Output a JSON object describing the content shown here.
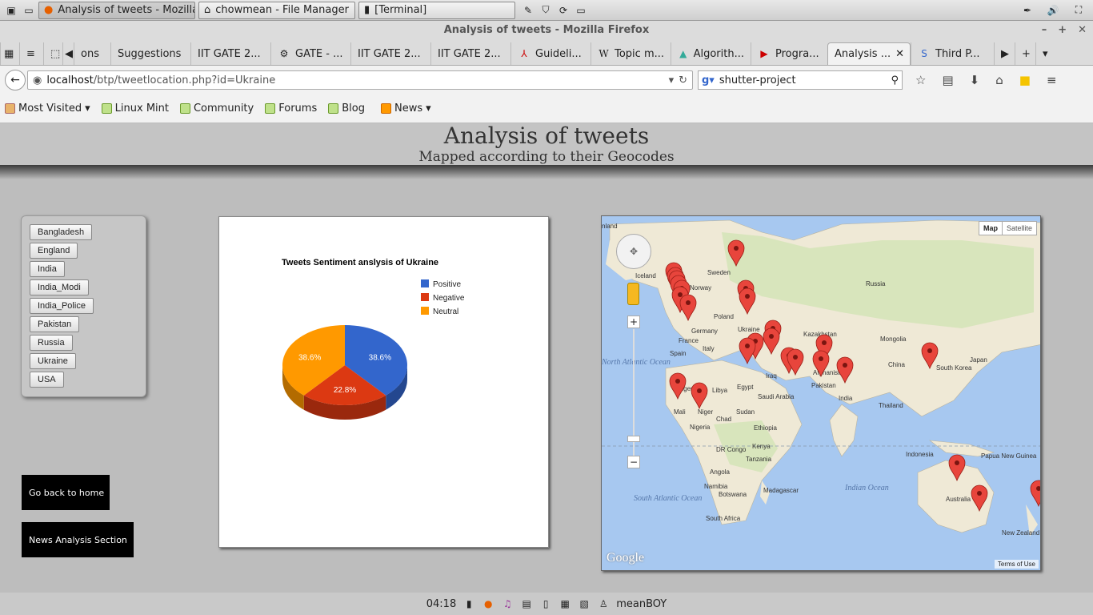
{
  "taskbar_top": {
    "tasks": [
      {
        "label": "Analysis of tweets - Mozilla..."
      },
      {
        "label": "chowmean - File Manager"
      },
      {
        "label": "[Terminal]"
      }
    ]
  },
  "window": {
    "title": "Analysis of tweets - Mozilla Firefox"
  },
  "tabs": [
    {
      "label": "ons"
    },
    {
      "label": "Suggestions"
    },
    {
      "label": "IIT GATE 2..."
    },
    {
      "label": "GATE - ..."
    },
    {
      "label": "IIT GATE 2..."
    },
    {
      "label": "IIT GATE 2..."
    },
    {
      "label": "Guideli..."
    },
    {
      "label": "Topic m..."
    },
    {
      "label": "Algorith..."
    },
    {
      "label": "Progra..."
    },
    {
      "label": "Analysis ..."
    },
    {
      "label": "Third P..."
    }
  ],
  "nav": {
    "url_host": "localhost",
    "url_path": "/btp/tweetlocation.php?id=Ukraine",
    "search_value": "shutter-project"
  },
  "bookmarks": [
    {
      "label": "Most Visited"
    },
    {
      "label": "Linux Mint"
    },
    {
      "label": "Community"
    },
    {
      "label": "Forums"
    },
    {
      "label": "Blog"
    },
    {
      "label": "News"
    }
  ],
  "page": {
    "title": "Analysis of tweets",
    "subtitle": "Mapped according to their Geocodes",
    "countries": [
      "Bangladesh",
      "England",
      "India",
      "India_Modi",
      "India_Police",
      "Pakistan",
      "Russia",
      "Ukraine",
      "USA"
    ],
    "home_button": "Go back to home",
    "news_button": "News Analysis Section"
  },
  "chart_data": {
    "type": "pie",
    "title": "Tweets Sentiment anslysis of Ukraine",
    "categories": [
      "Positive",
      "Negative",
      "Neutral"
    ],
    "values": [
      38.6,
      22.8,
      38.6
    ],
    "labels": [
      "38.6%",
      "22.8%",
      "38.6%"
    ],
    "colors": [
      "#3366cc",
      "#dc3912",
      "#ff9900"
    ],
    "legend_position": "right"
  },
  "map": {
    "map_type_buttons": [
      "Map",
      "Satellite"
    ],
    "labels": [
      "nland",
      "Iceland",
      "Sweden",
      "Norway",
      "Russia",
      "Poland",
      "Germany",
      "Ukraine",
      "Kazakhstan",
      "France",
      "Spain",
      "Italy",
      "Mongolia",
      "China",
      "Japan",
      "Iraq",
      "Algeria",
      "Libya",
      "Egypt",
      "Saudi Arabia",
      "Pakistan",
      "India",
      "Afghanistan",
      "Thailand",
      "Mali",
      "Niger",
      "Chad",
      "Sudan",
      "Nigeria",
      "Ethiopia",
      "Kenya",
      "DR Congo",
      "Tanzania",
      "Indonesia",
      "Papua New Guinea",
      "Angola",
      "Namibia",
      "Botswana",
      "Madagascar",
      "South Africa",
      "Australia",
      "New Zealand",
      "South Korea",
      "Indian Ocean",
      "South Atlantic Ocean",
      "North Atlantic Ocean"
    ],
    "terms": "Terms of Use",
    "brand": "Google"
  },
  "taskbar_bottom": {
    "time": "04:18",
    "user": "meanBOY"
  }
}
